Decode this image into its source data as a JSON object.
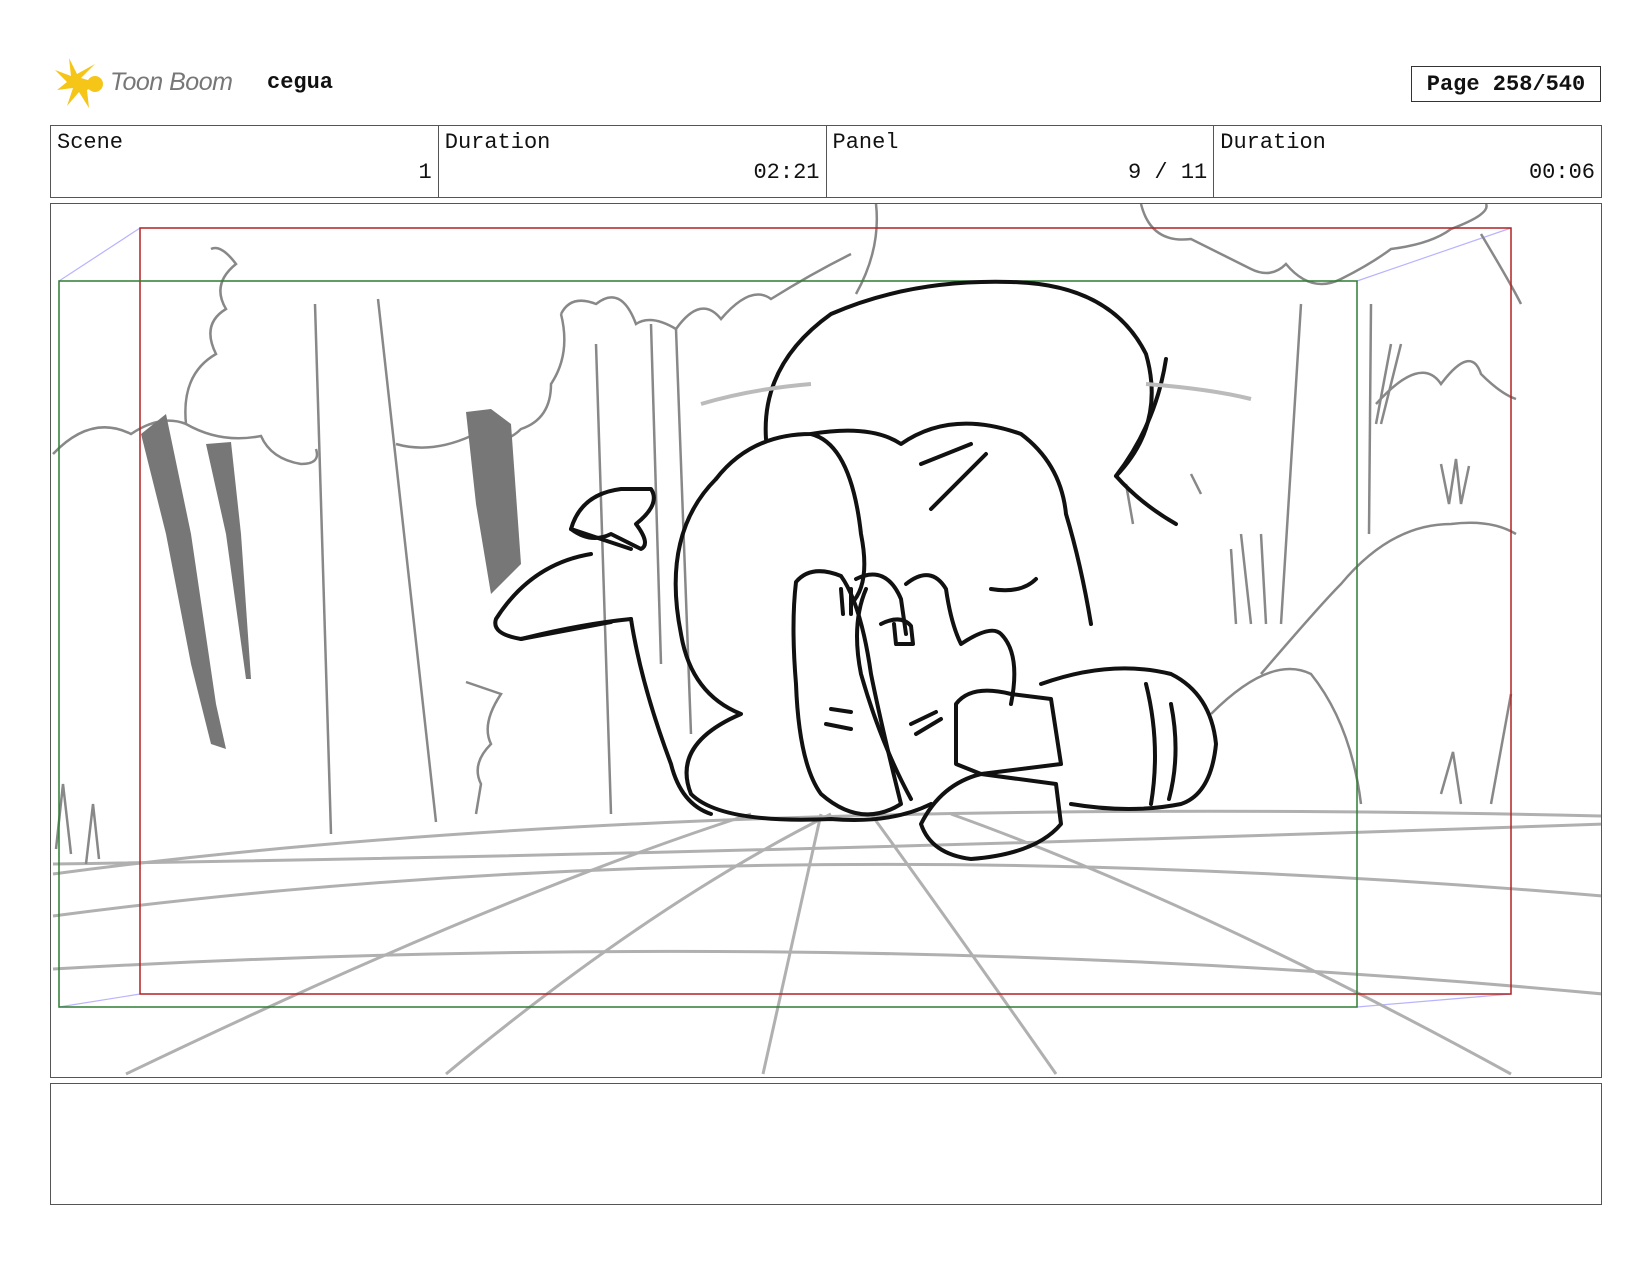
{
  "header": {
    "logo_text": "Toon Boom",
    "project_name": "cegua",
    "page_label": "Page 258/540"
  },
  "info": {
    "scene_label": "Scene",
    "scene_value": "1",
    "scene_duration_label": "Duration",
    "scene_duration_value": "02:21",
    "panel_label": "Panel",
    "panel_value": "9 / 11",
    "panel_duration_label": "Duration",
    "panel_duration_value": "00:06"
  },
  "notes": {
    "text": ""
  },
  "colors": {
    "logo_yellow": "#f5c518",
    "frame_red": "#b22222",
    "frame_green": "#2e7d32",
    "sketch_gray": "#888888",
    "sketch_black": "#111111"
  }
}
